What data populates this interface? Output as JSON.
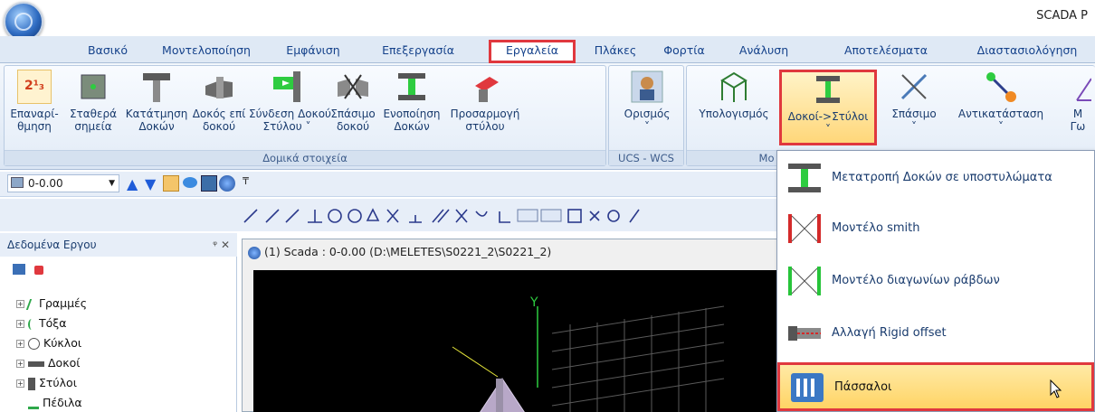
{
  "app": {
    "title": "SCADA P"
  },
  "tabs": [
    "Βασικό",
    "Μοντελοποίηση",
    "Εμφάνιση",
    "Επεξεργασία",
    "Εργαλεία",
    "Πλάκες",
    "Φορτία",
    "Ανάλυση",
    "Αποτελέσματα",
    "Διαστασιολόγηση"
  ],
  "ribbon": {
    "group1": {
      "label": "Δομικά στοιχεία",
      "buttons": [
        {
          "l1": "Επαναρί-",
          "l2": "θμηση",
          "icon": "renumber-icon",
          "badge": "2¹₃"
        },
        {
          "l1": "Σταθερά",
          "l2": "σημεία",
          "icon": "fixed-points-icon"
        },
        {
          "l1": "Κατάτμηση",
          "l2": "Δοκών",
          "icon": "beam-split-icon"
        },
        {
          "l1": "Δοκός επί",
          "l2": "δοκού",
          "icon": "beam-on-beam-icon"
        },
        {
          "l1": "Σύνδεση Δοκού",
          "l2": "Στύλου",
          "icon": "beam-column-connect-icon",
          "caret": true
        },
        {
          "l1": "Σπάσιμο",
          "l2": "δοκού",
          "icon": "beam-break-icon"
        },
        {
          "l1": "Ενοποίηση",
          "l2": "Δοκών",
          "icon": "beam-merge-icon"
        },
        {
          "l1": "Προσαρμογή",
          "l2": "στύλου",
          "icon": "column-adjust-icon"
        }
      ]
    },
    "group2": {
      "label": "UCS - WCS",
      "buttons": [
        {
          "l1": "Ορισμός",
          "l2": "",
          "icon": "ucs-define-icon",
          "caret": true
        }
      ]
    },
    "group3": {
      "label": "Μο",
      "buttons": [
        {
          "l1": "Υπολογισμός",
          "l2": "",
          "icon": "frame-calc-icon"
        },
        {
          "l1": "Δοκοί->Στύλοι",
          "l2": "",
          "icon": "beam-to-column-icon",
          "caret": true
        },
        {
          "l1": "Σπάσιμο",
          "l2": "",
          "icon": "break-icon",
          "caret": true
        },
        {
          "l1": "Αντικατάσταση",
          "l2": "",
          "icon": "replace-icon",
          "caret": true
        },
        {
          "l1": "Μ",
          "l2": "Γω",
          "icon": "angle-icon"
        }
      ]
    }
  },
  "toolbar": {
    "level": "0-0.00",
    "pin": "ᵠ"
  },
  "panel": {
    "title": "Δεδομένα Εργου",
    "pin": "ᵠ ✕",
    "items": [
      {
        "label": "Γραμμές",
        "icon": "line-icon"
      },
      {
        "label": "Τόξα",
        "icon": "arc-icon"
      },
      {
        "label": "Κύκλοι",
        "icon": "circle-icon"
      },
      {
        "label": "Δοκοί",
        "icon": "beam-icon"
      },
      {
        "label": "Στύλοι",
        "icon": "column-icon"
      },
      {
        "label": "Πέδιλα",
        "icon": "footing-icon"
      }
    ]
  },
  "document": {
    "title": "(1) Scada : 0-0.00 (D:\\MELETES\\S0221_2\\S0221_2)",
    "axis_label": "Y"
  },
  "menu": {
    "items": [
      {
        "label": "Μετατροπή Δοκών σε υποστυλώματα",
        "icon": "convert-beams-icon"
      },
      {
        "label": "Μοντέλο smith",
        "icon": "smith-model-icon",
        "color": "#d42a2a"
      },
      {
        "label": "Μοντέλο διαγωνίων ράβδων",
        "icon": "diagonal-bars-icon",
        "color": "#27c43a"
      },
      {
        "label": "Αλλαγή Rigid offset",
        "icon": "rigid-offset-icon"
      },
      {
        "label": "Πάσσαλοι",
        "icon": "pile-icon"
      }
    ]
  },
  "colors": {
    "accent": "#e0383e",
    "ribbon_text": "#15428b",
    "highlight": "#ffd77a"
  }
}
